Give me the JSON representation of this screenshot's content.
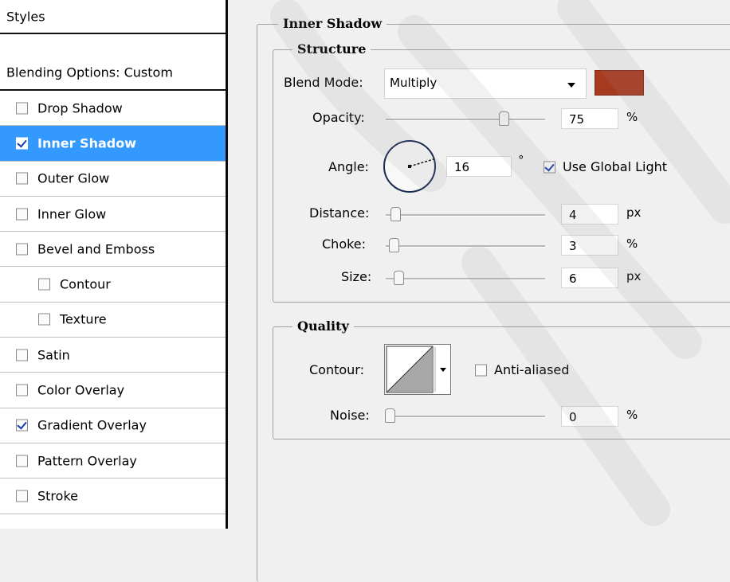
{
  "styles_list": {
    "header": "Styles",
    "blending_options": "Blending Options: Custom",
    "items": [
      {
        "label": "Drop Shadow",
        "checked": false
      },
      {
        "label": "Inner Shadow",
        "checked": true
      },
      {
        "label": "Outer Glow",
        "checked": false
      },
      {
        "label": "Inner Glow",
        "checked": false
      },
      {
        "label": "Bevel and Emboss",
        "checked": false
      },
      {
        "label": "Contour",
        "checked": false
      },
      {
        "label": "Texture",
        "checked": false
      },
      {
        "label": "Satin",
        "checked": false
      },
      {
        "label": "Color Overlay",
        "checked": false
      },
      {
        "label": "Gradient Overlay",
        "checked": true
      },
      {
        "label": "Pattern Overlay",
        "checked": false
      },
      {
        "label": "Stroke",
        "checked": false
      }
    ]
  },
  "panel": {
    "title": "Inner Shadow",
    "structure": {
      "title": "Structure",
      "blend_mode_label": "Blend Mode:",
      "blend_mode_value": "Multiply",
      "color": "#a83a1f",
      "opacity_label": "Opacity:",
      "opacity_value": "75",
      "opacity_unit": "%",
      "angle_label": "Angle:",
      "angle_value": "16",
      "angle_unit": "°",
      "use_global_light_label": "Use Global Light",
      "use_global_light": true,
      "distance_label": "Distance:",
      "distance_value": "4",
      "distance_unit": "px",
      "choke_label": "Choke:",
      "choke_value": "3",
      "choke_unit": "%",
      "size_label": "Size:",
      "size_value": "6",
      "size_unit": "px"
    },
    "quality": {
      "title": "Quality",
      "contour_label": "Contour:",
      "anti_aliased_label": "Anti-aliased",
      "anti_aliased": false,
      "noise_label": "Noise:",
      "noise_value": "0",
      "noise_unit": "%"
    }
  }
}
